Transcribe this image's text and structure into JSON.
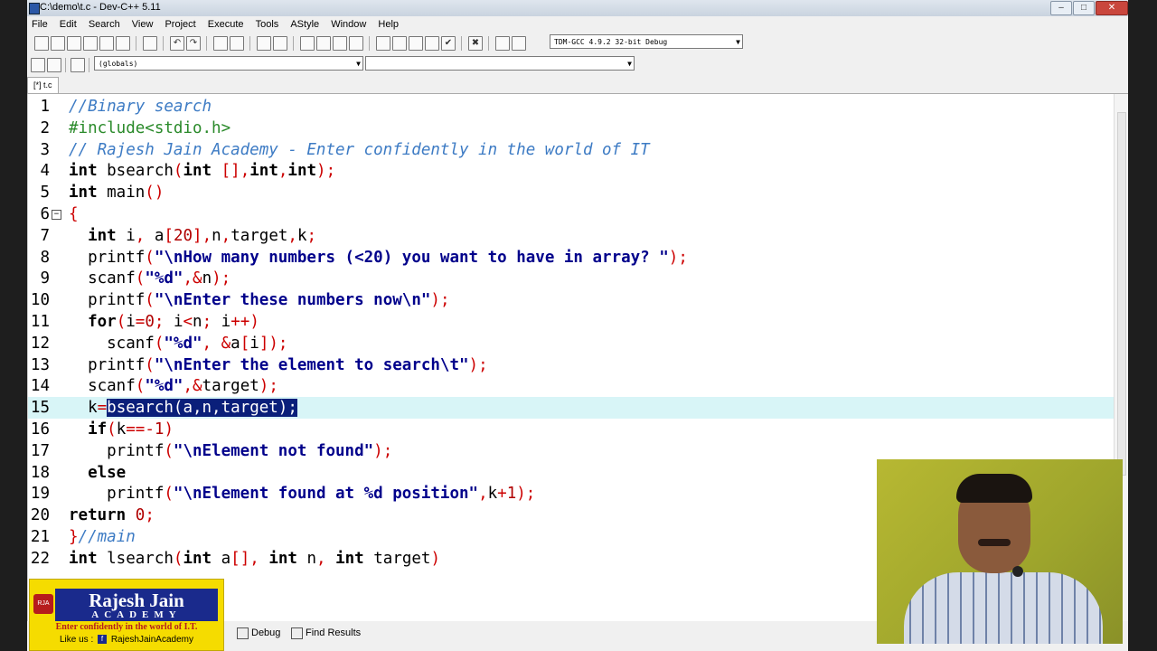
{
  "window": {
    "title": "C:\\demo\\t.c - Dev-C++ 5.11"
  },
  "menu": [
    "File",
    "Edit",
    "Search",
    "View",
    "Project",
    "Execute",
    "Tools",
    "AStyle",
    "Window",
    "Help"
  ],
  "toolbar": {
    "compiler": "TDM-GCC 4.9.2 32-bit Debug",
    "scope": "(globals)",
    "function": ""
  },
  "tab": {
    "label": "[*] t.c"
  },
  "editor": {
    "lines": [
      {
        "n": "1",
        "text": "//Binary search"
      },
      {
        "n": "2",
        "text": "#include<stdio.h>"
      },
      {
        "n": "3",
        "text": "// Rajesh Jain Academy - Enter confidently in the world of IT"
      },
      {
        "n": "4",
        "text": "int bsearch(int [],int,int);"
      },
      {
        "n": "5",
        "text": "int main()"
      },
      {
        "n": "6",
        "text": "{"
      },
      {
        "n": "7",
        "text": "  int i, a[20],n,target,k;"
      },
      {
        "n": "8",
        "text": "  printf(\"\\nHow many numbers (<20) you want to have in array? \");"
      },
      {
        "n": "9",
        "text": "  scanf(\"%d\",&n);"
      },
      {
        "n": "10",
        "text": "  printf(\"\\nEnter these numbers now\\n\");"
      },
      {
        "n": "11",
        "text": "  for(i=0; i<n; i++)"
      },
      {
        "n": "12",
        "text": "    scanf(\"%d\", &a[i]);"
      },
      {
        "n": "13",
        "text": "  printf(\"\\nEnter the element to search\\t\");"
      },
      {
        "n": "14",
        "text": "  scanf(\"%d\",&target);"
      },
      {
        "n": "15",
        "text": "  k=bsearch(a,n,target);"
      },
      {
        "n": "16",
        "text": "  if(k==-1)"
      },
      {
        "n": "17",
        "text": "    printf(\"\\nElement not found\");"
      },
      {
        "n": "18",
        "text": "  else"
      },
      {
        "n": "19",
        "text": "    printf(\"\\nElement found at %d position\",k+1);"
      },
      {
        "n": "20",
        "text": "return 0;"
      },
      {
        "n": "21",
        "text": "}//main"
      },
      {
        "n": "22",
        "text": "int lsearch(int a[], int n, int target)"
      }
    ],
    "current_line": 15,
    "selection": "bsearch(a,n,target);"
  },
  "bottom_tabs": [
    {
      "label": "Debug",
      "icon": "debug-icon"
    },
    {
      "label": "Find Results",
      "icon": "find-results-icon"
    }
  ],
  "logo": {
    "name": "Rajesh Jain",
    "academy": "ACADEMY",
    "tagline": "Enter confidently in the world of I.T.",
    "like_us": "Like us :",
    "facebook": "RajeshJainAcademy"
  },
  "colors": {
    "comment": "#3d7bc4",
    "preprocessor": "#2a8a2a",
    "string": "#00008b",
    "number": "#b00000",
    "operator": "#cc0000",
    "current_line_bg": "#d8f5f7",
    "selection_bg": "#0a1f7a"
  }
}
